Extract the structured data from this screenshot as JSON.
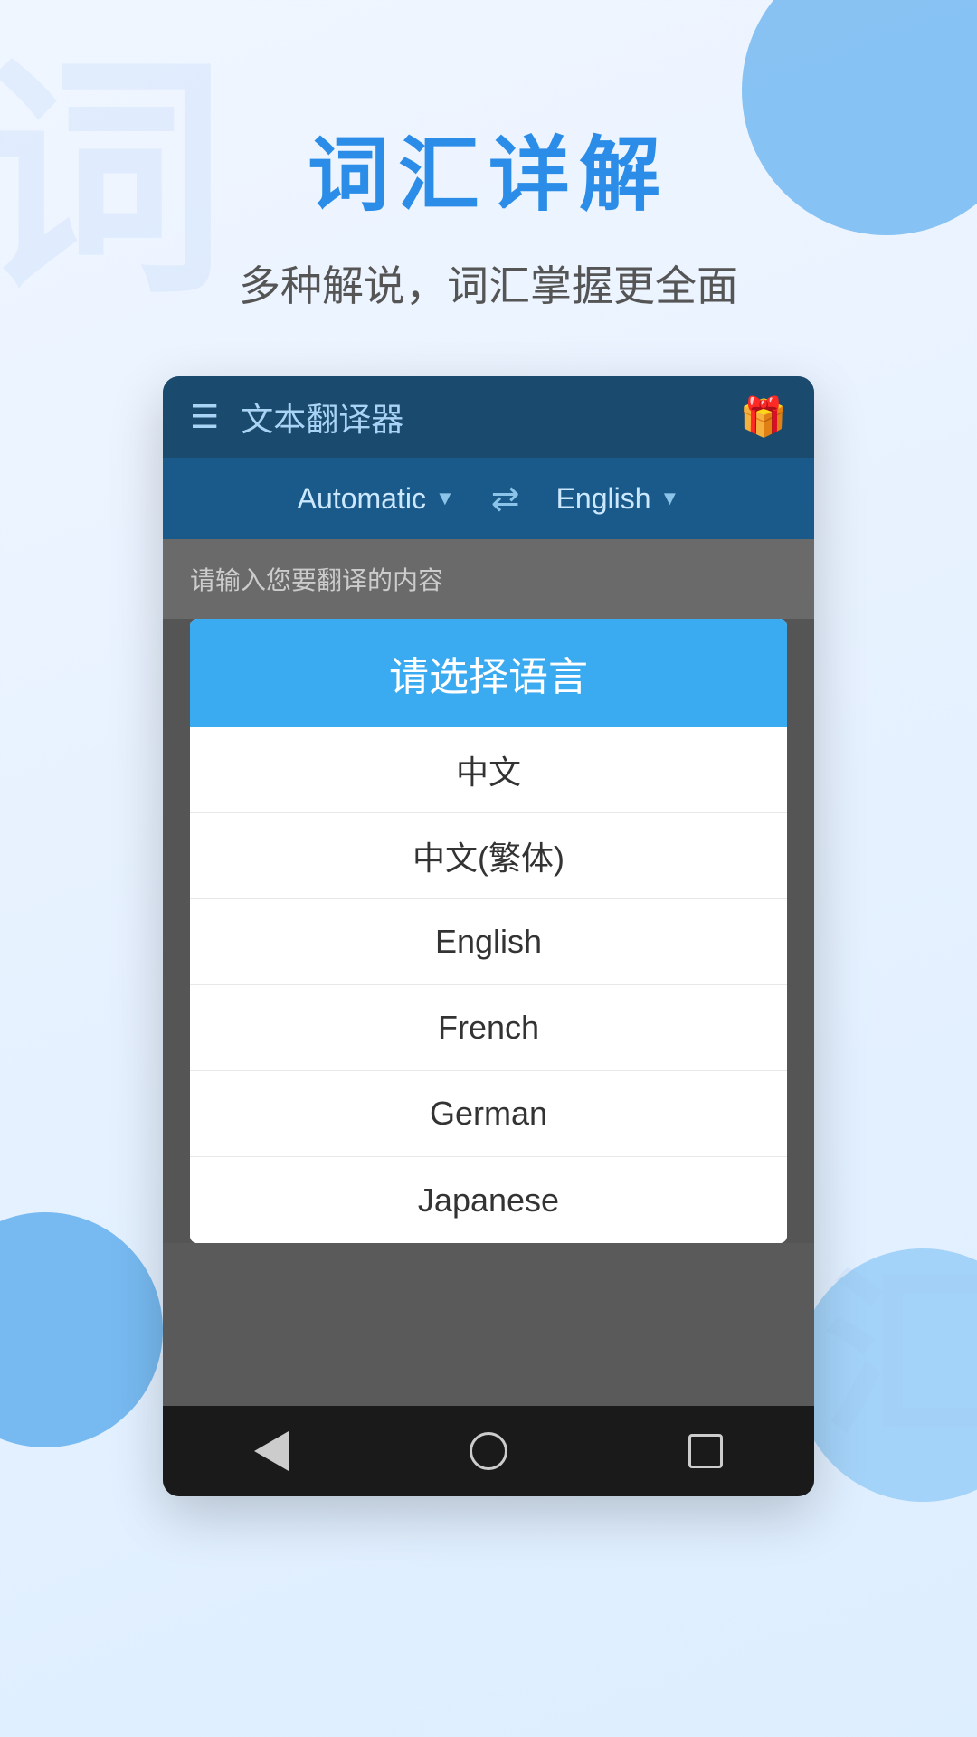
{
  "page": {
    "background": {
      "watermark1": "词",
      "watermark2": "汇"
    },
    "header": {
      "main_title": "词汇详解",
      "sub_title": "多种解说，词汇掌握更全面"
    },
    "app": {
      "topbar": {
        "title": "文本翻译器",
        "gift_icon": "🎁"
      },
      "lang_bar": {
        "source_lang": "Automatic",
        "target_lang": "English"
      },
      "input": {
        "placeholder": "请输入您要翻译的内容"
      },
      "dialog": {
        "title": "请选择语言",
        "items": [
          {
            "id": "zh",
            "label": "中文"
          },
          {
            "id": "zh-tw",
            "label": "中文(繁体)"
          },
          {
            "id": "en",
            "label": "English"
          },
          {
            "id": "fr",
            "label": "French"
          },
          {
            "id": "de",
            "label": "German"
          },
          {
            "id": "ja",
            "label": "Japanese"
          }
        ]
      }
    },
    "navbar": {
      "back_label": "back",
      "home_label": "home",
      "recent_label": "recent"
    }
  }
}
